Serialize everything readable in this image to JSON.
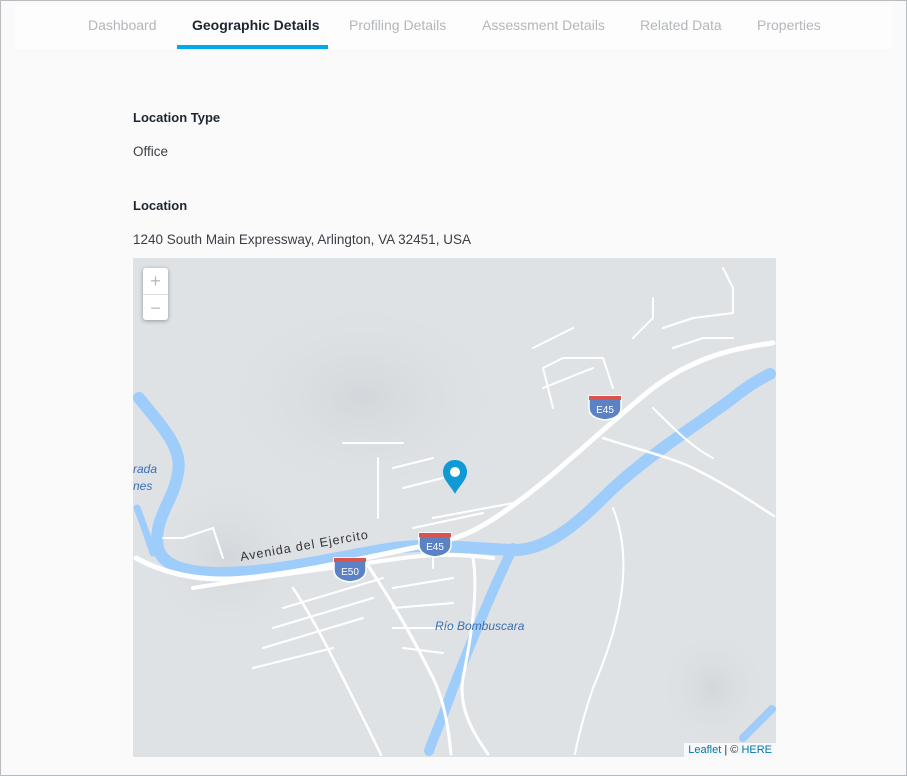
{
  "tabs": [
    {
      "label": "Dashboard",
      "active": false
    },
    {
      "label": "Geographic Details",
      "active": true
    },
    {
      "label": "Profiling Details",
      "active": false
    },
    {
      "label": "Assessment Details",
      "active": false
    },
    {
      "label": "Related Data",
      "active": false
    },
    {
      "label": "Properties",
      "active": false
    }
  ],
  "fields": {
    "location_type_label": "Location Type",
    "location_type_value": "Office",
    "location_label": "Location",
    "location_value": "1240 South Main Expressway, Arlington, VA 32451, USA"
  },
  "map": {
    "zoom_in": "+",
    "zoom_out": "−",
    "attribution": {
      "leaflet": "Leaflet",
      "separator": " | © ",
      "provider": "HERE"
    },
    "labels": {
      "street": "Avenida del Ejercito",
      "river": "Río Bombuscara",
      "left1": "rada",
      "left2": "nes"
    },
    "shields": [
      "E45",
      "E45",
      "E50"
    ],
    "colors": {
      "water": "#9fcdfb",
      "road": "#ffffff",
      "land": "#dfe2e5",
      "marker": "#0f9ad6",
      "shield": "#5b82c4"
    }
  }
}
